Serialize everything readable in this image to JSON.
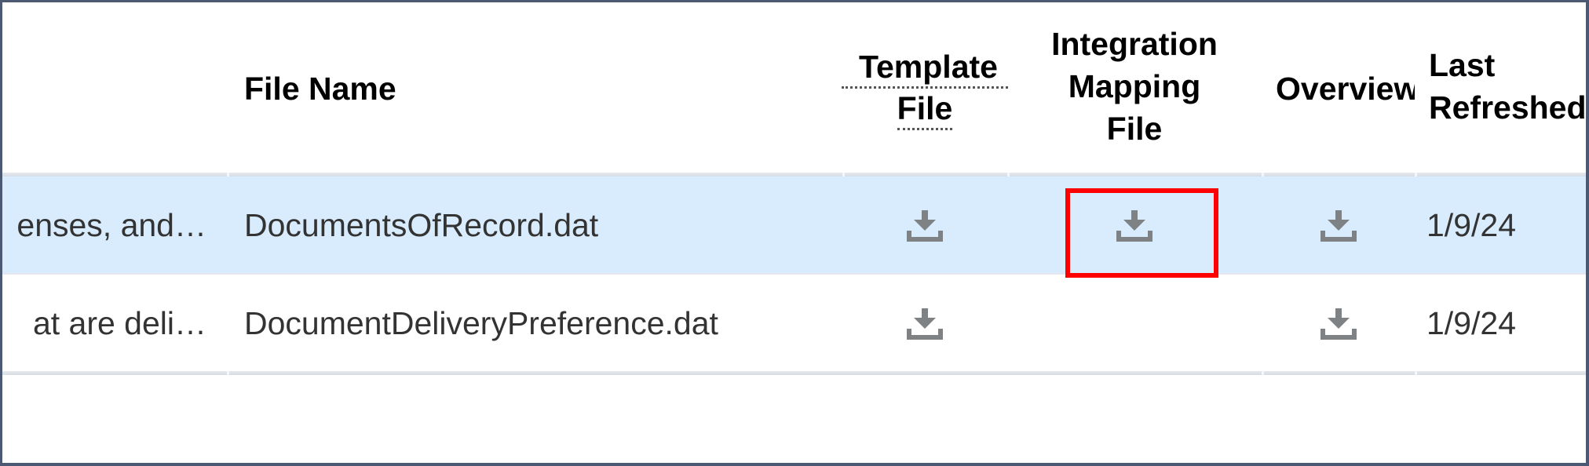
{
  "table": {
    "columns": [
      {
        "key": "description",
        "label": ""
      },
      {
        "key": "file_name",
        "label": "File Name"
      },
      {
        "key": "template_file",
        "label_line1": "Template",
        "label_line2": "File",
        "tooltip_underline": true
      },
      {
        "key": "integration_mapping_file",
        "label_line1": "Integration",
        "label_line2": "Mapping",
        "label_line3": "File"
      },
      {
        "key": "overview",
        "label": "Overview"
      },
      {
        "key": "last_refreshed",
        "label_line1": "Last",
        "label_line2": "Refreshed"
      }
    ],
    "rows": [
      {
        "description": "enses, and…",
        "file_name": "DocumentsOfRecord.dat",
        "template_file_icon": "download-icon",
        "integration_mapping_file_icon": "download-icon",
        "overview_icon": "download-icon",
        "last_refreshed": "1/9/24",
        "selected": true
      },
      {
        "description": "at are deli…",
        "file_name": "DocumentDeliveryPreference.dat",
        "template_file_icon": "download-icon",
        "integration_mapping_file_icon": null,
        "overview_icon": "download-icon",
        "last_refreshed": "1/9/24",
        "selected": false
      }
    ]
  },
  "colors": {
    "selected_row_bg": "#d9ecfd",
    "icon_gray": "#808080",
    "highlight_box": "#ff0000",
    "frame_border": "#4b5a72"
  },
  "annotation": {
    "highlighted_target": "row-1-integration-mapping-file-download"
  }
}
